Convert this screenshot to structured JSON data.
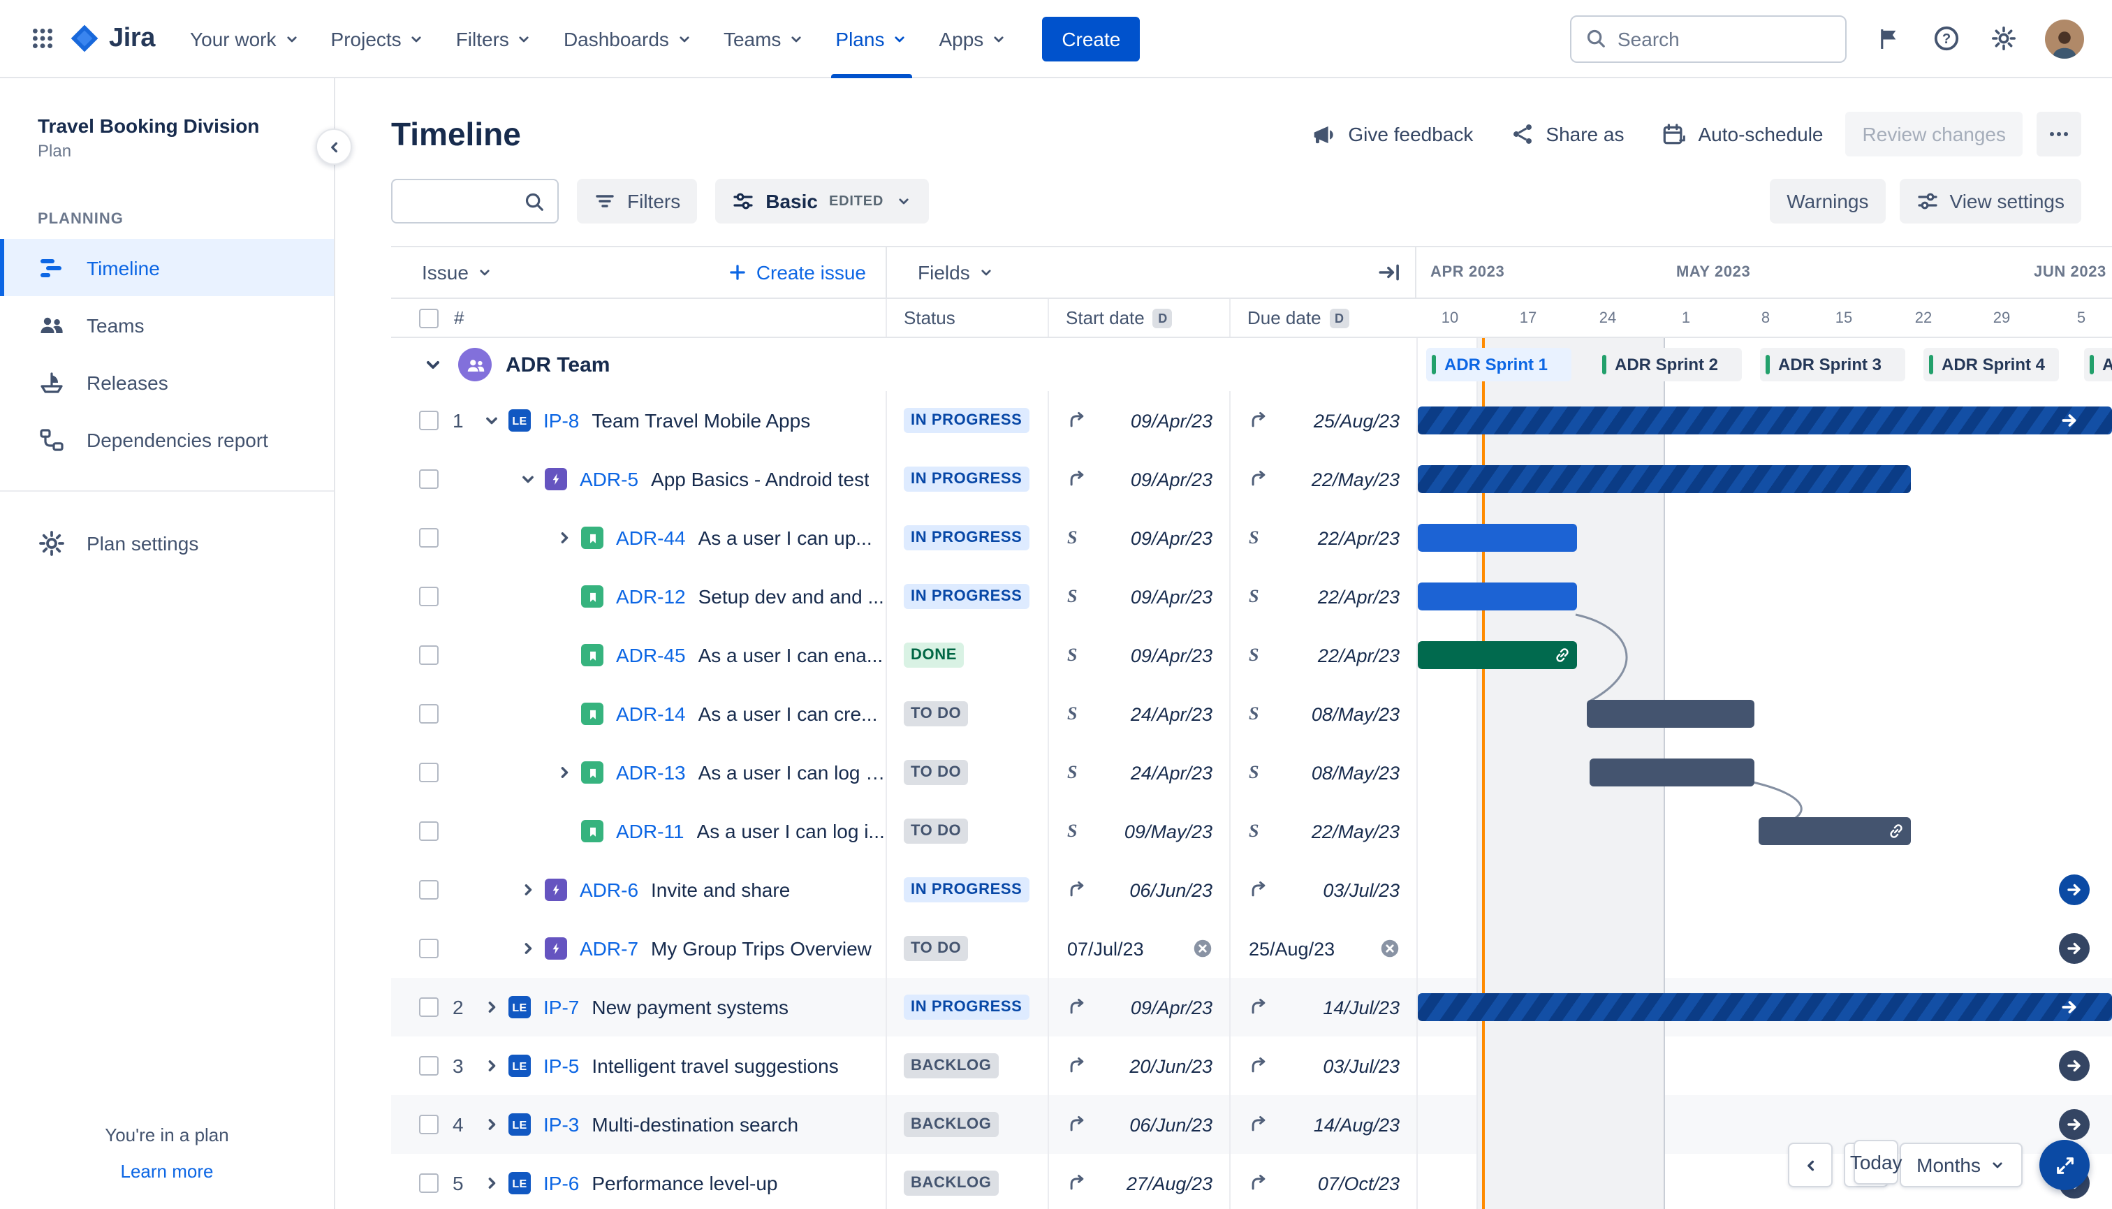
{
  "topnav": {
    "logo_text": "Jira",
    "menu": [
      {
        "label": "Your work"
      },
      {
        "label": "Projects"
      },
      {
        "label": "Filters"
      },
      {
        "label": "Dashboards"
      },
      {
        "label": "Teams"
      },
      {
        "label": "Plans",
        "active": true
      },
      {
        "label": "Apps"
      }
    ],
    "create_button": "Create",
    "search_placeholder": "Search"
  },
  "sidebar": {
    "plan_name": "Travel Booking Division",
    "plan_type": "Plan",
    "section_label": "PLANNING",
    "nav": [
      {
        "label": "Timeline",
        "active": true
      },
      {
        "label": "Teams"
      },
      {
        "label": "Releases"
      },
      {
        "label": "Dependencies report"
      }
    ],
    "settings_label": "Plan settings",
    "footer_note": "You're in a plan",
    "footer_link": "Learn more"
  },
  "page": {
    "title": "Timeline",
    "actions": {
      "give_feedback": "Give feedback",
      "share_as": "Share as",
      "auto_schedule": "Auto-schedule",
      "review_changes": "Review changes"
    }
  },
  "toolbar": {
    "filters_label": "Filters",
    "view_mode_label": "Basic",
    "view_mode_badge": "EDITED",
    "warnings_label": "Warnings",
    "view_settings_label": "View settings"
  },
  "grid_header": {
    "issue_label": "Issue",
    "create_issue_label": "Create issue",
    "fields_label": "Fields",
    "row_number_label": "#",
    "columns": {
      "status": "Status",
      "start": "Start date",
      "due": "Due date",
      "date_badge": "D"
    }
  },
  "timeline_header": {
    "months": [
      {
        "label": "APR 2023"
      },
      {
        "label": "MAY 2023"
      },
      {
        "label": "JUN 2023"
      }
    ],
    "ticks": [
      "10",
      "17",
      "24",
      "1",
      "8",
      "15",
      "22",
      "29",
      "5"
    ],
    "sprints": [
      {
        "label": "ADR Sprint 1",
        "active": true
      },
      {
        "label": "ADR Sprint 2"
      },
      {
        "label": "ADR Sprint 3"
      },
      {
        "label": "ADR Sprint 4"
      },
      {
        "label": "AD"
      }
    ]
  },
  "group": {
    "name": "ADR Team"
  },
  "rows": [
    {
      "num": "1",
      "type_badge": "LE",
      "key": "IP-8",
      "summary": "Team Travel Mobile Apps",
      "status": "IN PROGRESS",
      "start": "09/Apr/23",
      "due": "25/Aug/23"
    },
    {
      "key": "ADR-5",
      "summary": "App Basics - Android test",
      "status": "IN PROGRESS",
      "start": "09/Apr/23",
      "due": "22/May/23"
    },
    {
      "key": "ADR-44",
      "summary": "As a user I can up...",
      "status": "IN PROGRESS",
      "start": "09/Apr/23",
      "due": "22/Apr/23"
    },
    {
      "key": "ADR-12",
      "summary": "Setup dev and and ...",
      "status": "IN PROGRESS",
      "start": "09/Apr/23",
      "due": "22/Apr/23"
    },
    {
      "key": "ADR-45",
      "summary": "As a user I can ena...",
      "status": "DONE",
      "start": "09/Apr/23",
      "due": "22/Apr/23"
    },
    {
      "key": "ADR-14",
      "summary": "As a user I can cre...",
      "status": "TO DO",
      "start": "24/Apr/23",
      "due": "08/May/23"
    },
    {
      "key": "ADR-13",
      "summary": "As a user I can log i...",
      "status": "TO DO",
      "start": "24/Apr/23",
      "due": "08/May/23"
    },
    {
      "key": "ADR-11",
      "summary": "As a user I can log i...",
      "status": "TO DO",
      "start": "09/May/23",
      "due": "22/May/23"
    },
    {
      "key": "ADR-6",
      "summary": "Invite and share",
      "status": "IN PROGRESS",
      "start": "06/Jun/23",
      "due": "03/Jul/23"
    },
    {
      "key": "ADR-7",
      "summary": "My Group Trips Overview",
      "status": "TO DO",
      "start": "07/Jul/23",
      "due": "25/Aug/23"
    },
    {
      "num": "2",
      "type_badge": "LE",
      "key": "IP-7",
      "summary": "New payment systems",
      "status": "IN PROGRESS",
      "start": "09/Apr/23",
      "due": "14/Jul/23"
    },
    {
      "num": "3",
      "type_badge": "LE",
      "key": "IP-5",
      "summary": "Intelligent travel suggestions",
      "status": "BACKLOG",
      "start": "20/Jun/23",
      "due": "03/Jul/23"
    },
    {
      "num": "4",
      "type_badge": "LE",
      "key": "IP-3",
      "summary": "Multi-destination search",
      "status": "BACKLOG",
      "start": "06/Jun/23",
      "due": "14/Aug/23"
    },
    {
      "num": "5",
      "type_badge": "LE",
      "key": "IP-6",
      "summary": "Performance level-up",
      "status": "BACKLOG",
      "start": "27/Aug/23",
      "due": "07/Oct/23"
    }
  ],
  "controls": {
    "today_label": "Today",
    "zoom_label": "Months"
  }
}
